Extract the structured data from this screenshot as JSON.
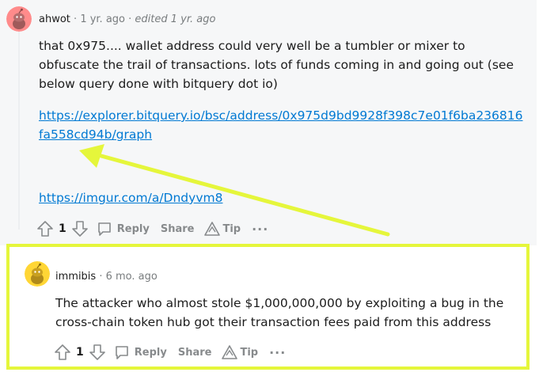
{
  "comments": [
    {
      "author": "ahwot",
      "separator": "·",
      "age": "1 yr. ago",
      "edited": "edited 1 yr. ago",
      "body": "that 0x975.... wallet address could very well be a tumbler or mixer to obfuscate the trail of transactions. lots of funds coming in and going out (see below query done with bitquery dot io)",
      "link_1": "https://explorer.bitquery.io/bsc/address/0x975d9bd9928f398c7e01f6ba236816fa558cd94b/graph",
      "link_2": "https://imgur.com/a/Dndyvm8",
      "votes": "1",
      "reply_label": "Reply",
      "share_label": "Share",
      "tip_label": "Tip",
      "more_label": "···",
      "avatar_color": "#ff8b8b"
    },
    {
      "author": "immibis",
      "separator": "·",
      "age": "6 mo. ago",
      "body": "The attacker who almost stole $1,000,000,000 by exploiting a bug in the cross-chain token hub got their transaction fees paid from this address",
      "votes": "1",
      "reply_label": "Reply",
      "share_label": "Share",
      "tip_label": "Tip",
      "more_label": "···",
      "avatar_color": "#ffd635"
    }
  ],
  "icons": [
    "upvote-icon",
    "downvote-icon",
    "reply-icon",
    "tip-icon",
    "more-icon"
  ],
  "colors": {
    "annotation": "#e5f63b",
    "link": "#0079d3",
    "panel_bg": "#f6f7f8",
    "meta_text": "#787c7e"
  }
}
